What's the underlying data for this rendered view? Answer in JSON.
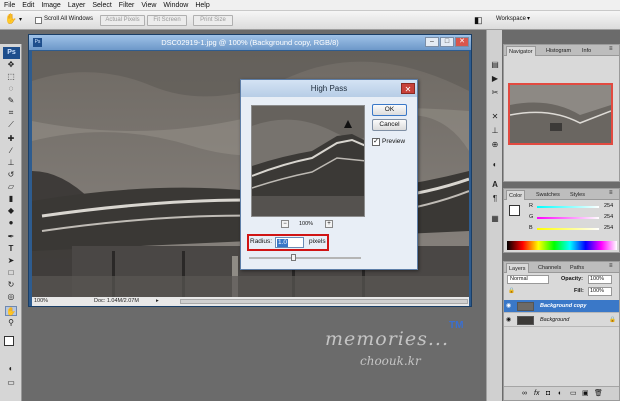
{
  "menu": [
    "File",
    "Edit",
    "Image",
    "Layer",
    "Select",
    "Filter",
    "View",
    "Window",
    "Help"
  ],
  "options_bar": {
    "scroll_all_windows": "Scroll All Windows",
    "actual_pixels": "Actual Pixels",
    "fit_screen": "Fit Screen",
    "print_size": "Print Size",
    "workspace": "Workspace"
  },
  "toolbox": {
    "logo": "Ps"
  },
  "document": {
    "title": "DSC02919-1.jpg @ 100% (Background copy, RGB/8)",
    "zoom": "100%",
    "doc_info": "Doc: 1.04M/2.07M"
  },
  "dialog": {
    "title": "High Pass",
    "ok": "OK",
    "cancel": "Cancel",
    "preview_label": "Preview",
    "preview_checked": true,
    "preview_zoom": "100%",
    "zoom_minus": "−",
    "zoom_plus": "+",
    "radius_label": "Radius:",
    "radius_value": "1.0",
    "radius_unit": "pixels",
    "close_glyph": "✕"
  },
  "panels": {
    "nav_tabs": [
      "Navigator",
      "Histogram",
      "Info"
    ],
    "color_tabs": [
      "Color",
      "Swatches",
      "Styles"
    ],
    "color_channels": [
      {
        "label": "R",
        "value": "254",
        "color": "#ff0000"
      },
      {
        "label": "G",
        "value": "254",
        "color": "#00c000"
      },
      {
        "label": "B",
        "value": "254",
        "color": "#0050ff"
      }
    ],
    "layers_tabs": [
      "Layers",
      "Channels",
      "Paths"
    ],
    "blend_mode": "Normal",
    "opacity_label": "Opacity:",
    "opacity_value": "100%",
    "fill_label": "Fill:",
    "fill_value": "100%",
    "layers": [
      {
        "name": "Background copy",
        "selected": true
      },
      {
        "name": "Background",
        "selected": false
      }
    ]
  },
  "watermark": {
    "line1": "memories...",
    "line2": "choouk.kr",
    "tm": "TM"
  },
  "colors": {
    "accent": "#3a78c8",
    "highlight_box": "#d01414"
  }
}
